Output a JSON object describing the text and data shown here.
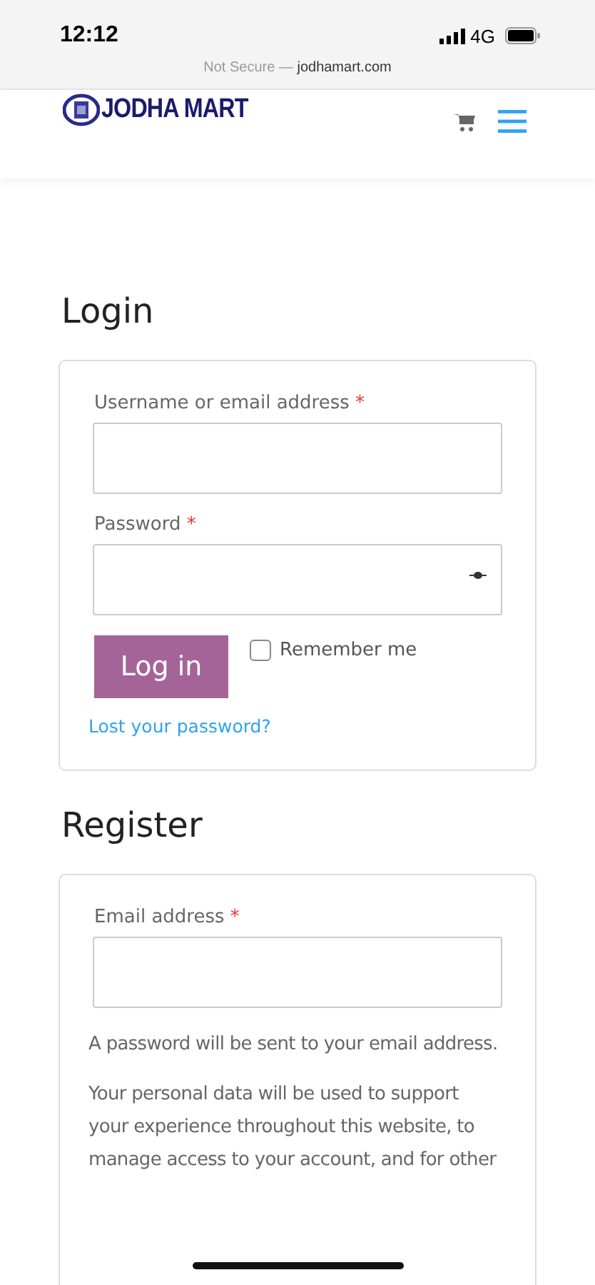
{
  "status_bar": {
    "time": "12:12",
    "network": "4G"
  },
  "address_bar": {
    "prefix": "Not Secure — ",
    "domain": "jodhamart.com"
  },
  "header": {
    "logo_text": "JODHA MART"
  },
  "login": {
    "title": "Login",
    "fields": [
      {
        "label": "Username or email address",
        "required_mark": "*",
        "kind": "text"
      },
      {
        "label": "Password",
        "required_mark": "*",
        "kind": "password"
      }
    ],
    "button": "Log in",
    "remember": {
      "label": "Remember me",
      "checked": false
    },
    "lost_link": "Lost your password?"
  },
  "register": {
    "title": "Register",
    "fields": [
      {
        "label": "Email address",
        "required_mark": "*"
      }
    ],
    "notes": [
      "A password will be sent to your email address.",
      "Your personal data will be used to support your experience throughout this website, to manage access to your account, and for other"
    ]
  }
}
